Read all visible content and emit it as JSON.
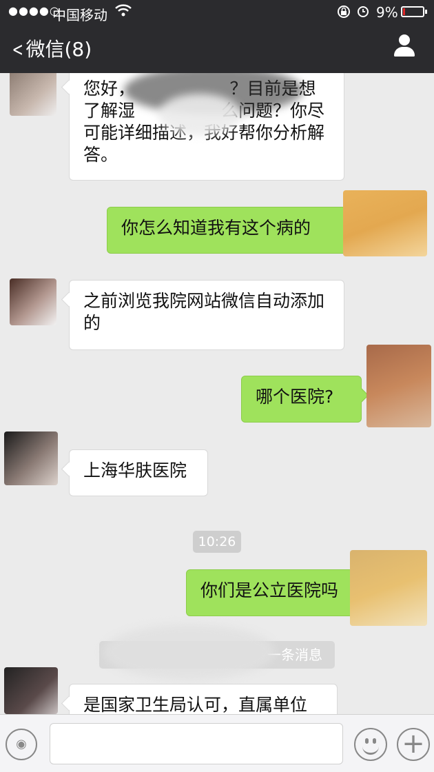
{
  "status_bar": {
    "signal": "●●●●○",
    "carrier": "中国移动",
    "battery_percent": "9%",
    "battery_level": 0.09,
    "battery_color": "#e0292a"
  },
  "nav": {
    "back_label": "微信(8)"
  },
  "messages": {
    "m1": "您好，　　　　　　？目前是想了解湿　　　　　么问题？你尽可能详细描述，我好帮你分析解答。",
    "m2": "你怎么知道我有这个病的",
    "m3": "之前浏览我院网站微信自动添加的",
    "m4": "哪个医院?",
    "m5": "上海华肤医院",
    "time": "10:26",
    "m6": "你们是公立医院吗",
    "notice": "一条消息",
    "m7": "是国家卫生局认可，直属单位"
  },
  "colors": {
    "nav_bg": "#2b2b2e",
    "chat_bg": "#ebebeb",
    "bubble_out": "#9fe25c",
    "bubble_in": "#ffffff"
  },
  "icons": [
    "chevron-left-icon",
    "wifi-icon",
    "lock-rotation-icon",
    "alarm-icon",
    "battery-icon",
    "profile-icon",
    "voice-icon",
    "emoji-icon",
    "plus-icon"
  ]
}
